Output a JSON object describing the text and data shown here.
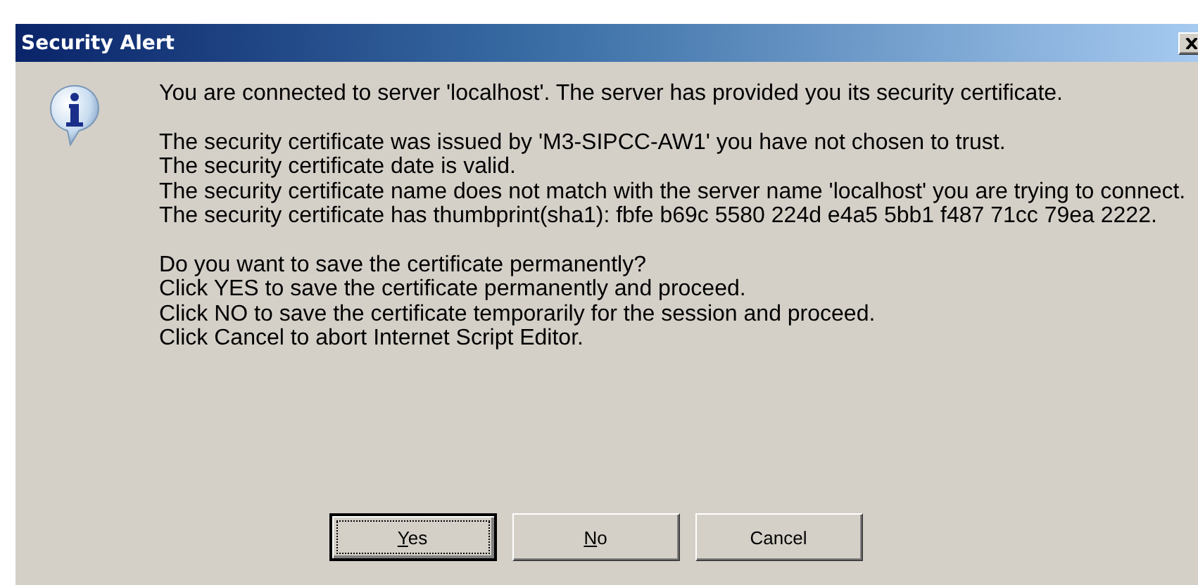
{
  "window": {
    "title": "Security Alert"
  },
  "paragraphs": [
    [
      "You are connected to server 'localhost'. The server has provided you its security certificate."
    ],
    [
      "The security certificate was issued by 'M3-SIPCC-AW1' you have not chosen to trust.",
      "The security certificate date is valid.",
      "The security certificate name does not match with the server name 'localhost' you are trying to connect.",
      "The security certificate has thumbprint(sha1): fbfe b69c 5580 224d e4a5 5bb1 f487 71cc 79ea 2222."
    ],
    [
      "Do you want to save the certificate permanently?",
      "Click YES to save the certificate permanently and proceed.",
      "Click NO to save the certificate temporarily for the session and proceed.",
      "Click Cancel to abort Internet Script Editor."
    ]
  ],
  "buttons": [
    {
      "label": "Yes",
      "first_letter_underlined": true,
      "default": true
    },
    {
      "label": "No",
      "first_letter_underlined": true,
      "default": false
    },
    {
      "label": "Cancel",
      "default": false
    }
  ]
}
